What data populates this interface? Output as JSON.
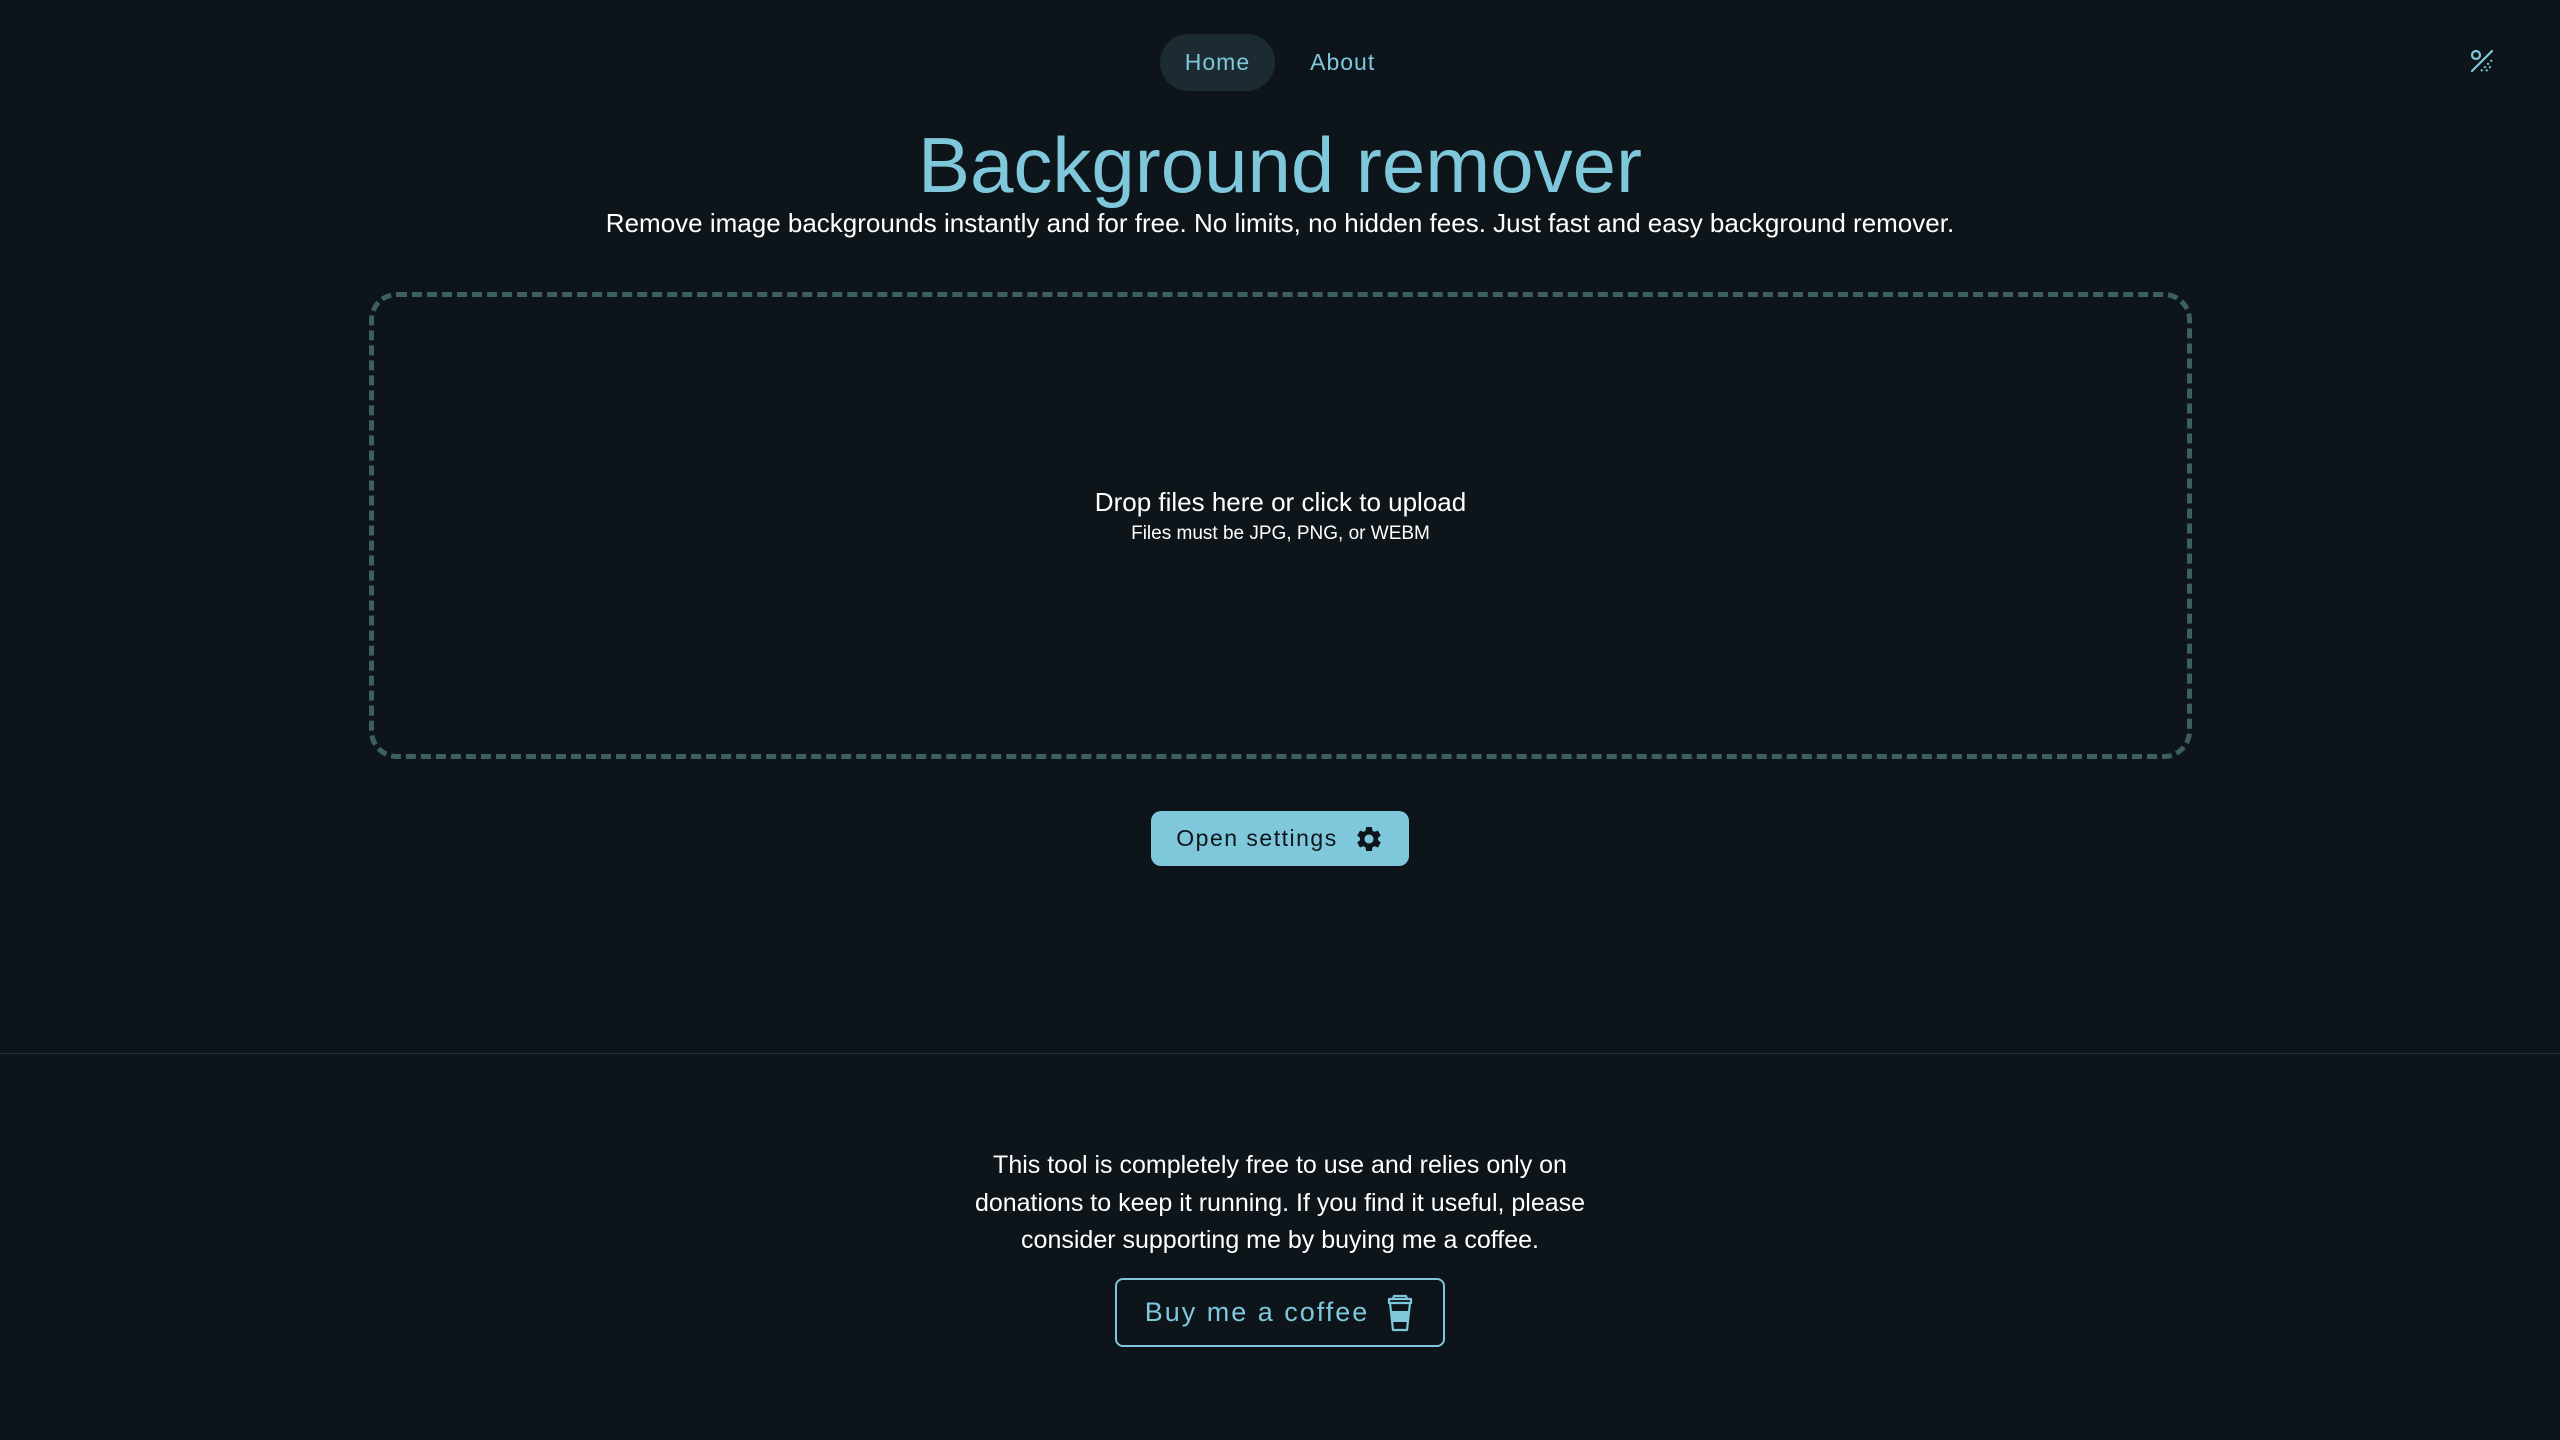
{
  "nav": {
    "items": [
      {
        "label": "Home",
        "active": true
      },
      {
        "label": "About",
        "active": false
      }
    ]
  },
  "theme_toggle": {
    "icon": "theme-toggle-icon"
  },
  "header": {
    "title": "Background remover",
    "subtitle": "Remove image backgrounds instantly and for free. No limits, no hidden fees. Just fast and easy background remover."
  },
  "dropzone": {
    "title": "Drop files here or click to upload",
    "subtitle": "Files must be JPG, PNG, or WEBM"
  },
  "settings": {
    "label": "Open settings",
    "icon": "gear-icon"
  },
  "footer": {
    "donate_text": "This tool is completely free to use and relies only on donations to keep it running. If you find it useful, please consider supporting me by buying me a coffee.",
    "coffee_label": "Buy me a coffee",
    "coffee_icon": "coffee-cup-icon"
  },
  "colors": {
    "background": "#0e151a",
    "accent": "#7fc8dc",
    "nav_active_bg": "#1b2b31",
    "dropzone_border": "#3d5f62",
    "divider": "#263238"
  }
}
